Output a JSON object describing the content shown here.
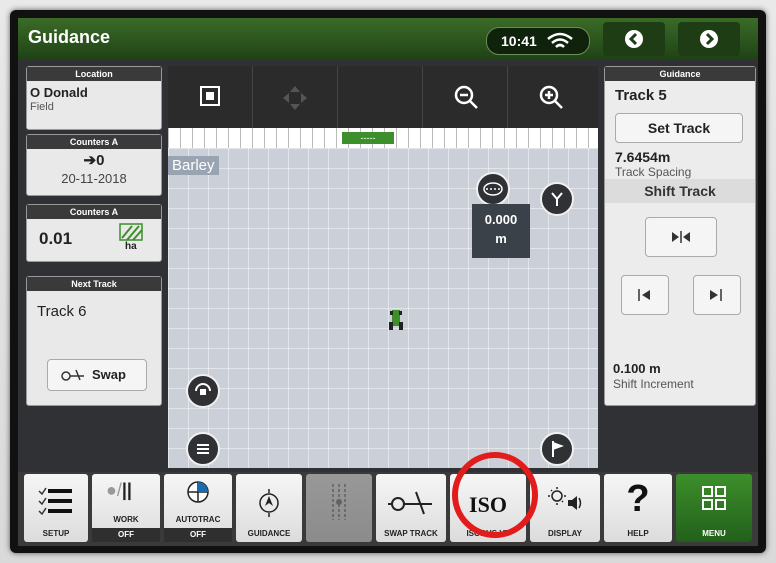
{
  "topbar": {
    "title": "Guidance",
    "time": "10:41"
  },
  "location": {
    "header": "Location",
    "name": "O Donald",
    "sub": "Field"
  },
  "counters_a1": {
    "header": "Counters A",
    "value": "➔0",
    "date": "20-11-2018"
  },
  "counters_a2": {
    "header": "Counters A",
    "value": "0.01",
    "unit": "ha"
  },
  "next_track": {
    "header": "Next Track",
    "value": "Track 6",
    "swap_label": "Swap"
  },
  "map": {
    "crop": "Barley",
    "offset_value": "0.000",
    "offset_unit": "m",
    "lightbar_center": "-----"
  },
  "guidance_panel": {
    "header": "Guidance",
    "track": "Track 5",
    "set_track": "Set Track",
    "spacing_value": "7.6454m",
    "spacing_label": "Track Spacing",
    "shift_title": "Shift Track",
    "increment_value": "0.100 m",
    "increment_label": "Shift Increment"
  },
  "dock": {
    "setup": "SETUP",
    "work": "WORK",
    "work_state": "OFF",
    "autotrac": "AUTOTRAC",
    "autotrac_state": "OFF",
    "guidance": "GUIDANCE",
    "swap": "SWAP TRACK",
    "iso_big": "ISO",
    "isobus": "ISOBUS VT",
    "display": "DISPLAY",
    "help": "HELP",
    "menu": "MENU"
  },
  "colors": {
    "brand_green": "#3b6b27",
    "highlight_red": "#e21b1b"
  }
}
